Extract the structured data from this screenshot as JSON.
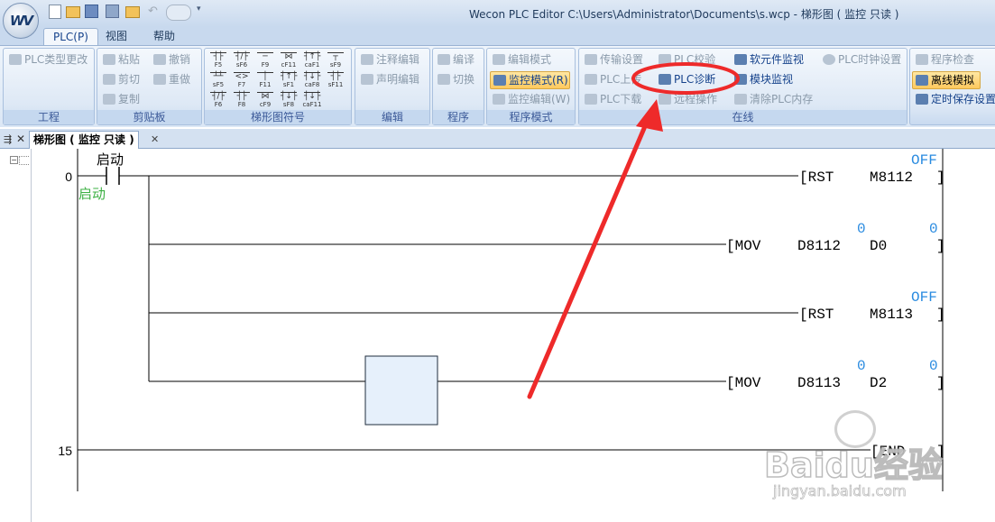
{
  "app": {
    "title": "Wecon PLC Editor  C:\\Users\\Administrator\\Documents\\s.wcp  - 梯形图 ( 监控 只读 )"
  },
  "tabs": [
    {
      "label": "PLC(P)"
    },
    {
      "label": "视图"
    },
    {
      "label": "帮助"
    }
  ],
  "ribbon": {
    "project": {
      "label": "工程",
      "plc_type_change": "PLC类型更改"
    },
    "clipboard": {
      "label": "剪贴板",
      "paste": "粘贴",
      "cut": "剪切",
      "copy": "复制",
      "undo": "撤销",
      "redo": "重做"
    },
    "ladder_symbols": {
      "label": "梯形图符号",
      "symbols": [
        "F5",
        "sF6",
        "F9",
        "cF11",
        "caF1",
        "sF9",
        "sF5",
        "F7",
        "F11",
        "sF1",
        "caF8",
        "sF11",
        "F6",
        "F8",
        "cF9",
        "sF8",
        "caF11",
        ""
      ]
    },
    "edit": {
      "label": "编辑",
      "comment_edit": "注释编辑",
      "statement_edit": "声明编辑"
    },
    "program": {
      "label": "程序",
      "compile": "编译",
      "switch": "切换"
    },
    "program_mode": {
      "label": "程序模式",
      "edit_mode": "编辑模式",
      "monitor_mode": "监控模式(R)",
      "monitor_edit": "监控编辑(W)"
    },
    "online": {
      "label": "在线",
      "transfer_settings": "传输设置",
      "plc_upload": "PLC上传",
      "plc_download": "PLC下载",
      "plc_verify": "PLC校验",
      "plc_diagnose": "PLC诊断",
      "remote_op": "远程操作",
      "device_monitor": "软元件监视",
      "module_monitor": "模块监视",
      "clear_memory": "清除PLC内存",
      "plc_clock": "PLC时钟设置"
    },
    "right": {
      "program_check": "程序检查",
      "offline_sim": "离线模拟",
      "timed_save": "定时保存设置"
    }
  },
  "doc_tab": {
    "label": "梯形图 ( 监控 只读 )"
  },
  "ladder": {
    "rung0": {
      "step": "0",
      "contact_label": "启动",
      "contact_comment": "启动",
      "rst1": {
        "op": "[RST",
        "operand": "M8112",
        "state": "OFF",
        "close": "]"
      },
      "mov1": {
        "op": "[MOV",
        "src": "D8112",
        "dst": "D0",
        "src_val": "0",
        "dst_val": "0",
        "close": "]"
      },
      "rst2": {
        "op": "[RST",
        "operand": "M8113",
        "state": "OFF",
        "close": "]"
      },
      "mov2": {
        "op": "[MOV",
        "src": "D8113",
        "dst": "D2",
        "src_val": "0",
        "dst_val": "0",
        "close": "]"
      }
    },
    "rung15": {
      "step": "15",
      "op": "[END",
      "close": "]"
    }
  },
  "watermark": {
    "text": "Baidu经验",
    "url": "jingyan.baidu.com"
  }
}
